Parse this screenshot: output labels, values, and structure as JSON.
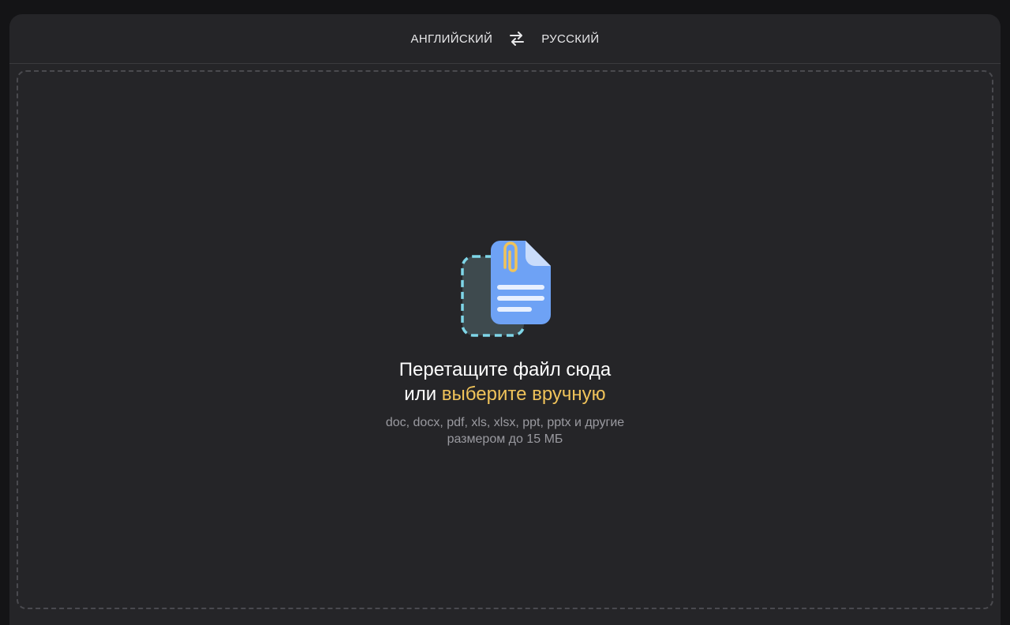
{
  "languages": {
    "source": "АНГЛИЙСКИЙ",
    "target": "РУССКИЙ",
    "swap_icon": "swap-arrows-icon"
  },
  "dropzone": {
    "title_line1": "Перетащите файл сюда",
    "title_line2_prefix": "или",
    "title_line2_link": "выберите вручную",
    "formats": "doc, docx, pdf, xls, xlsx, ppt, pptx и другие",
    "size_limit": "размером до 15 МБ",
    "illustration_icon": "file-attachment-icon"
  },
  "colors": {
    "background": "#141416",
    "panel": "#252528",
    "accent_link": "#f0c35a",
    "file_blue": "#6ea2f5"
  }
}
